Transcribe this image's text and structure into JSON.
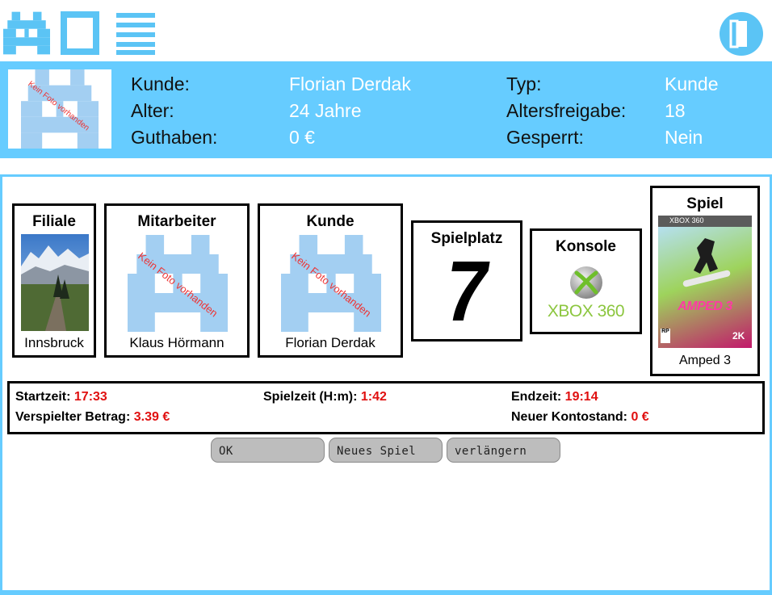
{
  "customer": {
    "photo_text": "Kein Foto vorhanden",
    "fields": [
      {
        "label": "Kunde:",
        "value": "Florian Derdak"
      },
      {
        "label": "Alter:",
        "value": "24 Jahre"
      },
      {
        "label": "Guthaben:",
        "value": "0 €"
      },
      {
        "label": "Typ:",
        "value": "Kunde"
      },
      {
        "label": "Altersfreigabe:",
        "value": "18"
      },
      {
        "label": "Gesperrt:",
        "value": "Nein"
      }
    ]
  },
  "cards": {
    "filiale": {
      "title": "Filiale",
      "caption": "Innsbruck"
    },
    "mitarbeiter": {
      "title": "Mitarbeiter",
      "caption": "Klaus Hörmann",
      "photo_text": "Kein Foto vorhanden"
    },
    "kunde": {
      "title": "Kunde",
      "caption": "Florian Derdak",
      "photo_text": "Kein Foto vorhanden"
    },
    "spielplatz": {
      "title": "Spielplatz",
      "number": "7"
    },
    "konsole": {
      "title": "Konsole",
      "logo_text": "XBOX 360"
    },
    "spiel": {
      "title": "Spiel",
      "caption": "Amped 3",
      "cover_platform": "XBOX 360",
      "cover_title": "AMPED 3",
      "rating": "RP",
      "publisher": "2K"
    }
  },
  "summary": {
    "startzeit_label": "Startzeit:",
    "startzeit": "17:33",
    "spielzeit_label": "Spielzeit (H:m):",
    "spielzeit": "1:42",
    "endzeit_label": "Endzeit:",
    "endzeit": "19:14",
    "betrag_label": "Verspielter Betrag:",
    "betrag": "3.39 €",
    "kontostand_label": "Neuer Kontostand:",
    "kontostand": "0 €"
  },
  "buttons": {
    "ok": "OK",
    "neues_spiel": "Neues Spiel",
    "verlaengern": "verlängern"
  },
  "colors": {
    "accent": "#66ccff",
    "value_red": "#e01010",
    "button_gray": "#bdbdbd"
  }
}
